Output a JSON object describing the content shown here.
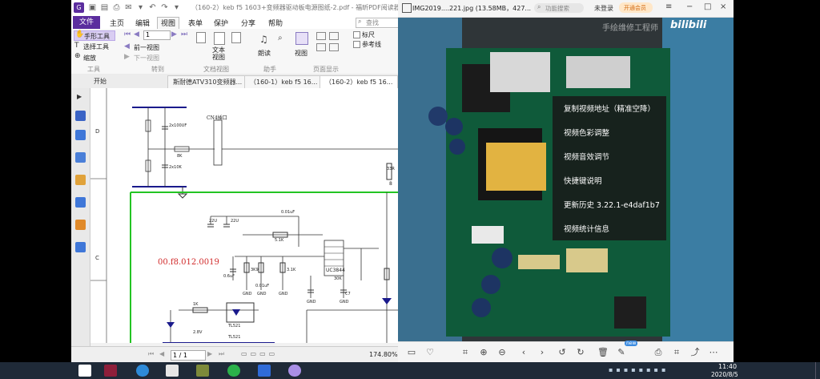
{
  "pdf_app": {
    "title": "（160-2）keb f5 1603+变频器驱动板电源图纸-2.pdf - 福昕PDF阅读器",
    "menu": [
      "文件",
      "主页",
      "编辑",
      "视图",
      "表单",
      "保护",
      "分享",
      "帮助"
    ],
    "active_menu": "视图",
    "search_placeholder": "查找",
    "ribbon": {
      "hand_tool": "手形工具",
      "select_tool": "选择工具",
      "zoom_tool": "缩放",
      "page_input": "1",
      "prev_view": "前一视图",
      "next_view": "下一视图",
      "text_view": "文本\n视图",
      "reflow": "朗读",
      "layout": "视图",
      "ruler": "标尺",
      "guides": "参考线",
      "groups": [
        "工具",
        "转到",
        "文档视图",
        "助手",
        "页面显示"
      ]
    },
    "tabs": [
      "开始",
      "斯耐德ATV310变频器...",
      "（160-1）keb f5 16...",
      "（160-2）keb f5 16..."
    ],
    "schematic": {
      "cn_label": "CN4插口",
      "red_text": "00.f8.012.0019",
      "ic_label": "UC3844",
      "labels": [
        "2x100UF",
        "2x10K",
        "0.01uF",
        "5.1K",
        "3K9",
        "3.1K",
        "30K",
        "22U",
        "22U",
        "1K",
        "2.8V",
        "TL521",
        "TL521",
        "33R",
        "GND",
        "GND",
        "GND",
        "GND",
        "GND",
        "C7",
        "0.6uF",
        "0.01uF",
        "8K",
        "8"
      ],
      "row_labels": [
        "D",
        "C"
      ]
    },
    "status": {
      "page": "1 / 1",
      "zoom": "174.80%"
    }
  },
  "video_app": {
    "title": "IMG2019....221.jpg (13.58MB，427...",
    "search_placeholder": "功能搜索",
    "login": "未登录",
    "vip": "开通会员",
    "watermark": "手绘维修工程师",
    "logo": "bilibili",
    "context_menu": [
      "复制视频地址（精准空降）",
      "视频色彩调整",
      "视频音效调节",
      "快捷键说明",
      "更新历史 3.22.1-e4daf1b7",
      "视频统计信息"
    ],
    "badge": "new"
  },
  "taskbar": {
    "time": "11:40",
    "date": "2020/8/5"
  },
  "colors": {
    "accent": "#5b2d9e",
    "wire_green": "#23c423",
    "wire_blue": "#1a1a8c",
    "text_red": "#d12a2a"
  }
}
